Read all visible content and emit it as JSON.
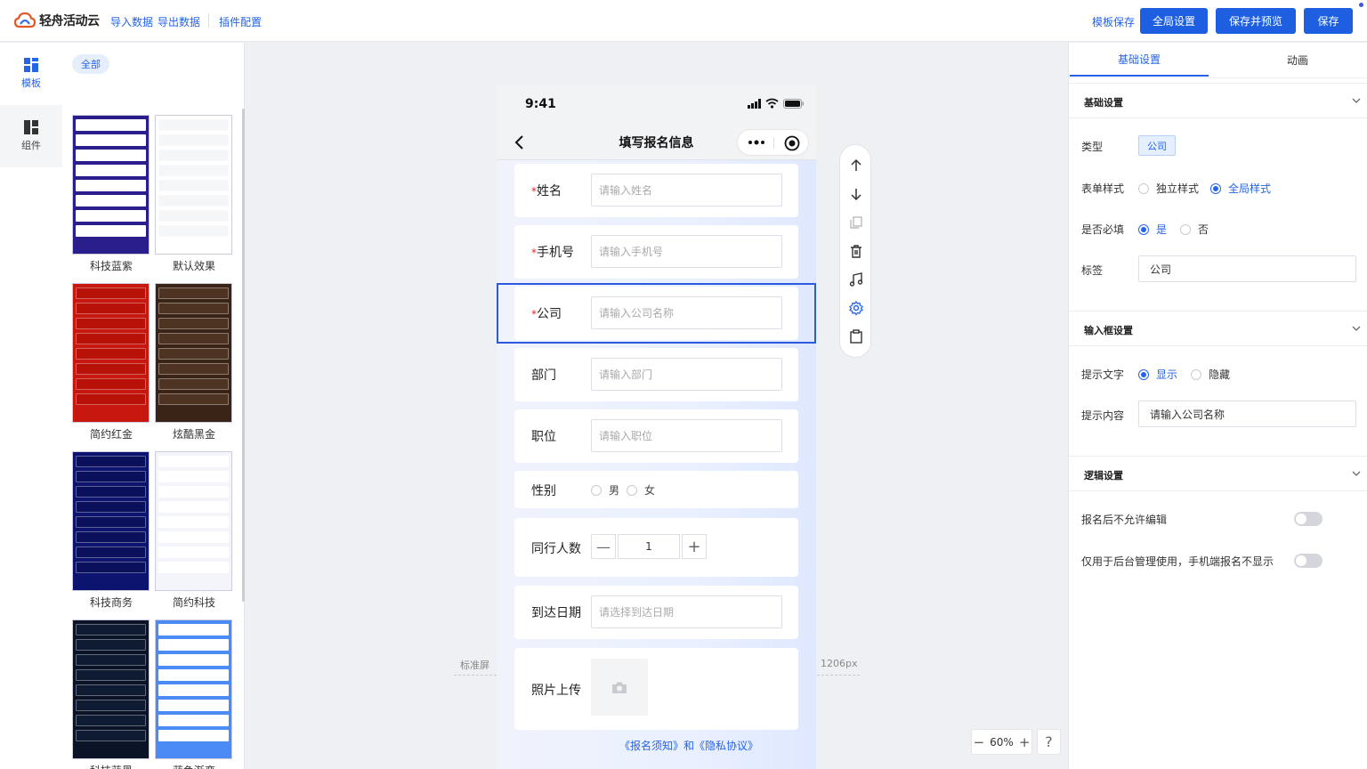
{
  "app": {
    "name": "轻舟活动云"
  },
  "topbar": {
    "import_label": "导入数据",
    "export_label": "导出数据",
    "plugin_label": "插件配置",
    "template_save_label": "模板保存",
    "global_settings_label": "全局设置",
    "save_preview_label": "保存并预览",
    "save_label": "保存"
  },
  "rail": {
    "items": [
      {
        "label": "模板",
        "icon": "template-grid-icon"
      },
      {
        "label": "组件",
        "icon": "component-grid-icon"
      }
    ]
  },
  "templates": {
    "filter_label": "全部",
    "items": [
      {
        "label": "科技蓝紫",
        "bg": "#2a1d8c",
        "row": "#ffffff"
      },
      {
        "label": "默认效果",
        "bg": "#ffffff",
        "row": "#f5f6f8"
      },
      {
        "label": "简约红金",
        "bg": "#c8170f",
        "row": "#b81208"
      },
      {
        "label": "炫酷黑金",
        "bg": "#3a2418",
        "row": "#4f3322"
      },
      {
        "label": "科技商务",
        "bg": "#0d1470",
        "row": "#0a105c"
      },
      {
        "label": "简约科技",
        "bg": "#f3f5fb",
        "row": "#ffffff"
      },
      {
        "label": "科技蓝黑",
        "bg": "#0b1426",
        "row": "#0f1b33"
      },
      {
        "label": "蓝色渐变",
        "bg": "#4a8bf5",
        "row": "#ffffff"
      }
    ]
  },
  "canvas": {
    "left_label": "标准屏",
    "right_label": "1206px",
    "zoom": "60%",
    "help": "?"
  },
  "phone": {
    "time": "9:41",
    "title": "填写报名信息",
    "fields": [
      {
        "label": "姓名",
        "required": true,
        "placeholder": "请输入姓名"
      },
      {
        "label": "手机号",
        "required": true,
        "placeholder": "请输入手机号"
      },
      {
        "label": "公司",
        "required": true,
        "placeholder": "请输入公司名称"
      },
      {
        "label": "部门",
        "required": false,
        "placeholder": "请输入部门"
      },
      {
        "label": "职位",
        "required": false,
        "placeholder": "请输入职位"
      }
    ],
    "gender": {
      "label": "性别",
      "options": [
        "男",
        "女"
      ]
    },
    "companions": {
      "label": "同行人数",
      "value": "1"
    },
    "arrival": {
      "label": "到达日期",
      "placeholder": "请选择到达日期"
    },
    "photo": {
      "label": "照片上传"
    },
    "agreement": "《报名须知》和《隐私协议》"
  },
  "props": {
    "tabs": [
      "基础设置",
      "动画"
    ],
    "basic": {
      "title": "基础设置",
      "type_label": "类型",
      "type_value": "公司",
      "form_style_label": "表单样式",
      "form_style_options": [
        "独立样式",
        "全局样式"
      ],
      "required_label": "是否必填",
      "required_options": [
        "是",
        "否"
      ],
      "tag_label": "标签",
      "tag_value": "公司"
    },
    "input": {
      "title": "输入框设置",
      "hint_label": "提示文字",
      "hint_options": [
        "显示",
        "隐藏"
      ],
      "hint_content_label": "提示内容",
      "hint_content_value": "请输入公司名称"
    },
    "logic": {
      "title": "逻辑设置",
      "no_edit_label": "报名后不允许编辑",
      "backend_only_label": "仅用于后台管理使用，手机端报名不显示"
    }
  },
  "colors": {
    "accent": "#1d5fe0",
    "required": "#e0262b"
  }
}
